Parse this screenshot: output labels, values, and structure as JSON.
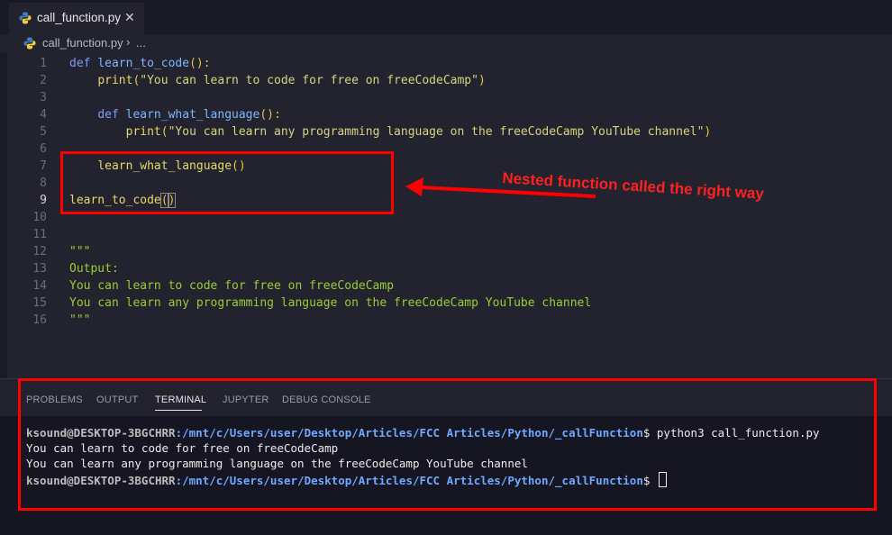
{
  "tab": {
    "label": "call_function.py",
    "close": "✕"
  },
  "breadcrumb": {
    "file": "call_function.py",
    "separator": "›",
    "more": "..."
  },
  "editor": {
    "lines": [
      {
        "num": "1",
        "segments": [
          {
            "t": "def ",
            "c": "kw"
          },
          {
            "t": "learn_to_code",
            "c": "fn"
          },
          {
            "t": "():",
            "c": "pp"
          }
        ]
      },
      {
        "num": "2",
        "segments": [
          {
            "t": "    "
          },
          {
            "t": "print",
            "c": "bi"
          },
          {
            "t": "(",
            "c": "pp"
          },
          {
            "t": "\"You can learn to code for free on freeCodeCamp\"",
            "c": "str"
          },
          {
            "t": ")",
            "c": "pp"
          }
        ]
      },
      {
        "num": "3",
        "segments": []
      },
      {
        "num": "4",
        "segments": [
          {
            "t": "    "
          },
          {
            "t": "def ",
            "c": "kw"
          },
          {
            "t": "learn_what_language",
            "c": "fn"
          },
          {
            "t": "():",
            "c": "pp"
          }
        ]
      },
      {
        "num": "5",
        "segments": [
          {
            "t": "        "
          },
          {
            "t": "print",
            "c": "bi"
          },
          {
            "t": "(",
            "c": "pp"
          },
          {
            "t": "\"You can learn any programming language on the freeCodeCamp YouTube channel\"",
            "c": "str"
          },
          {
            "t": ")",
            "c": "pp"
          }
        ]
      },
      {
        "num": "6",
        "segments": []
      },
      {
        "num": "7",
        "segments": [
          {
            "t": "    "
          },
          {
            "t": "learn_what_language",
            "c": "bi"
          },
          {
            "t": "()",
            "c": "pp"
          }
        ]
      },
      {
        "num": "8",
        "segments": []
      },
      {
        "num": "9",
        "active": true,
        "segments": [
          {
            "t": "learn_to_code",
            "c": "bi"
          },
          {
            "t": "(",
            "c": "pp bracket-hl"
          },
          {
            "t": ")",
            "c": "pp bracket-hl"
          }
        ]
      },
      {
        "num": "10",
        "segments": []
      },
      {
        "num": "11",
        "segments": []
      },
      {
        "num": "12",
        "segments": [
          {
            "t": "\"\"\"",
            "c": "cm"
          }
        ]
      },
      {
        "num": "13",
        "segments": [
          {
            "t": "Output:",
            "c": "cm"
          }
        ]
      },
      {
        "num": "14",
        "segments": [
          {
            "t": "You can learn to code for free on freeCodeCamp",
            "c": "cm"
          }
        ]
      },
      {
        "num": "15",
        "segments": [
          {
            "t": "You can learn any programming language on the freeCodeCamp YouTube channel",
            "c": "cm"
          }
        ]
      },
      {
        "num": "16",
        "segments": [
          {
            "t": "\"\"\"",
            "c": "cm"
          }
        ]
      }
    ]
  },
  "annotation": {
    "text": "Nested function called the right way",
    "color": "#ff0000"
  },
  "panel": {
    "tabs": [
      "PROBLEMS",
      "OUTPUT",
      "TERMINAL",
      "JUPYTER",
      "DEBUG CONSOLE"
    ],
    "active_tab": "TERMINAL"
  },
  "terminal": {
    "user_host": "ksound@DESKTOP-3BGCHRR",
    "path": ":/mnt/c/Users/user/Desktop/Articles/FCC Articles/Python/_callFunction",
    "command": "$ python3 call_function.py",
    "output_1": "You can learn to code for free on freeCodeCamp",
    "output_2": "You can learn any programming language on the freeCodeCamp YouTube channel",
    "prompt_end": "$ "
  }
}
